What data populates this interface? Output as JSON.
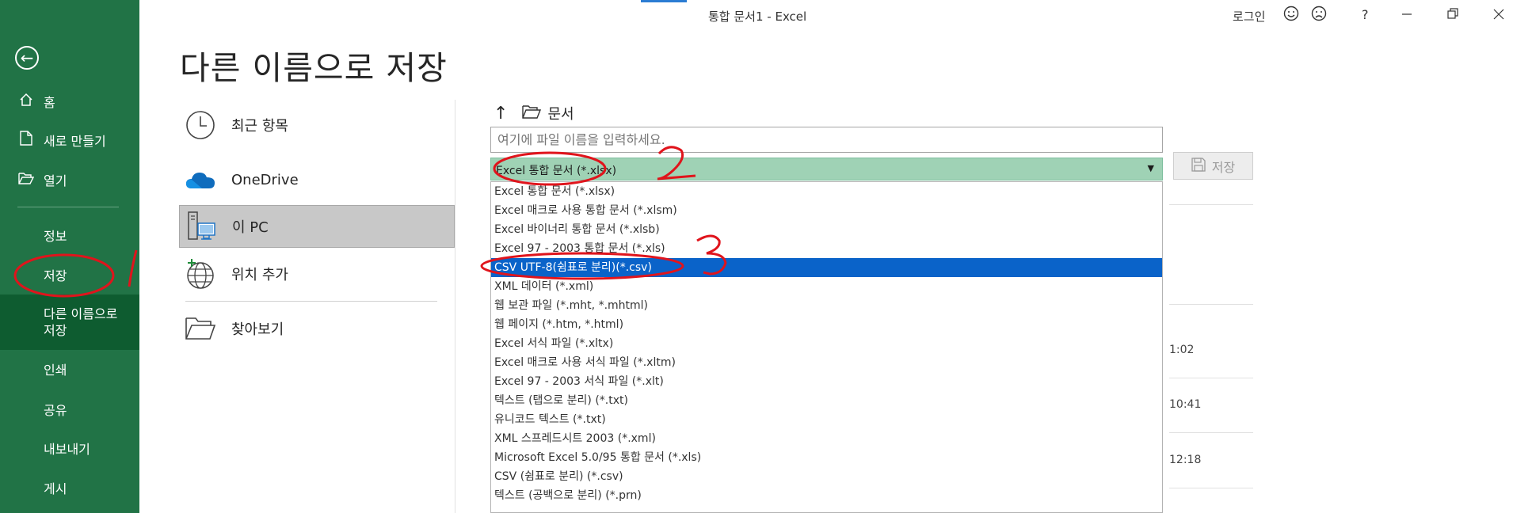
{
  "window": {
    "title": "통합 문서1  -  Excel",
    "login_label": "로그인",
    "help_label": "?"
  },
  "sidebar": {
    "back_icon": "back-arrow-icon",
    "items": [
      {
        "label": "홈",
        "icon": "home-icon"
      },
      {
        "label": "새로 만들기",
        "icon": "new-document-icon"
      },
      {
        "label": "열기",
        "icon": "open-folder-icon"
      },
      {
        "label": "정보"
      },
      {
        "label": "저장"
      },
      {
        "label": "다른 이름으로 저장",
        "active": true
      },
      {
        "label": "인쇄"
      },
      {
        "label": "공유"
      },
      {
        "label": "내보내기"
      },
      {
        "label": "게시"
      }
    ]
  },
  "page": {
    "title": "다른 이름으로 저장"
  },
  "locations": [
    {
      "label": "최근 항목",
      "icon": "clock-icon"
    },
    {
      "label": "OneDrive",
      "icon": "onedrive-cloud-icon"
    },
    {
      "label": "이 PC",
      "icon": "this-pc-icon",
      "selected": true
    },
    {
      "label": "위치 추가",
      "icon": "add-location-globe-icon"
    },
    {
      "label": "찾아보기",
      "icon": "browse-folder-icon"
    }
  ],
  "file_area": {
    "breadcrumb_folder": "문서",
    "filename_placeholder": "여기에 파일 이름을 입력하세요.",
    "filetype_selected": "Excel 통합 문서 (*.xlsx)",
    "save_label": "저장",
    "options": [
      "Excel 통합 문서 (*.xlsx)",
      "Excel 매크로 사용 통합 문서 (*.xlsm)",
      "Excel 바이너리 통합 문서 (*.xlsb)",
      "Excel 97 - 2003 통합 문서 (*.xls)",
      "CSV UTF-8(쉼표로 분리)(*.csv)",
      "XML 데이터 (*.xml)",
      "웹 보관 파일 (*.mht, *.mhtml)",
      "웹 페이지 (*.htm, *.html)",
      "Excel 서식 파일 (*.xltx)",
      "Excel 매크로 사용 서식 파일 (*.xltm)",
      "Excel 97 - 2003 서식 파일 (*.xlt)",
      "텍스트 (탭으로 분리) (*.txt)",
      "유니코드 텍스트 (*.txt)",
      "XML 스프레드시트 2003 (*.xml)",
      "Microsoft Excel 5.0/95 통합 문서 (*.xls)",
      "CSV (쉼표로 분리) (*.csv)",
      "텍스트 (공백으로 분리) (*.prn)"
    ],
    "selected_option_index": 4
  },
  "recent_times": [
    "1:02",
    "10:41",
    "12:18"
  ],
  "annotations": {
    "color": "#e0141c",
    "numbers": [
      "1",
      "2",
      "3"
    ]
  },
  "colors": {
    "excel_green": "#217346",
    "nav_active": "#0e5c30",
    "filetype_bg": "#9fd2b5",
    "selection_blue": "#0a63c9"
  }
}
